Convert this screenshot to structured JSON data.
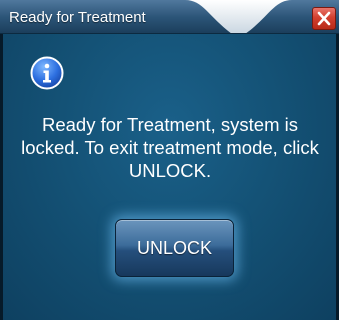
{
  "window": {
    "title": "Ready for Treatment"
  },
  "dialog": {
    "icon": "info-icon",
    "message": "Ready for Treatment, system is locked.  To exit treatment mode, click UNLOCK.",
    "unlock_label": "UNLOCK"
  },
  "colors": {
    "background": "#145276",
    "close_button": "#d2402f",
    "button_glow": "#78c8ff"
  }
}
